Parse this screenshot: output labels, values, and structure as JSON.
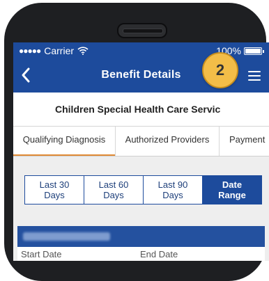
{
  "status_bar": {
    "carrier": "Carrier",
    "battery": "100%"
  },
  "nav": {
    "title": "Benefit Details"
  },
  "program": {
    "name": "Children Special Health Care Servic"
  },
  "badge": {
    "step": "2"
  },
  "tabs": [
    {
      "label": "Qualifying Diagnosis",
      "active": true
    },
    {
      "label": "Authorized Providers",
      "active": false
    },
    {
      "label": "Payment",
      "active": false
    }
  ],
  "date_ranges": [
    {
      "line1": "Last 30",
      "line2": "Days",
      "active": false
    },
    {
      "line1": "Last 60",
      "line2": "Days",
      "active": false
    },
    {
      "line1": "Last 90",
      "line2": "Days",
      "active": false
    },
    {
      "line1": "Date",
      "line2": "Range",
      "active": true
    }
  ],
  "result": {
    "start_label": "Start Date",
    "end_label": "End Date"
  },
  "colors": {
    "brand": "#1d4b9c",
    "accent": "#e08a34",
    "badge": "#f3bd48"
  }
}
